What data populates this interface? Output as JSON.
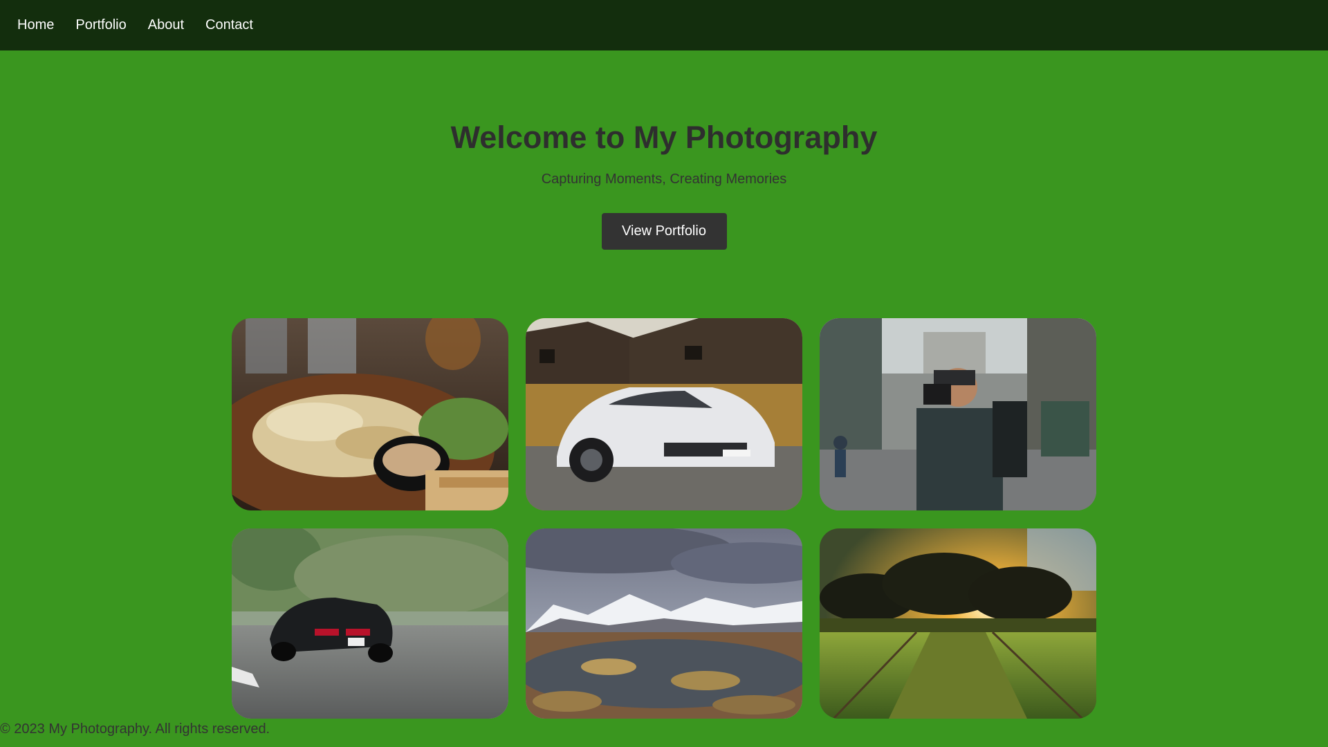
{
  "nav": {
    "items": [
      {
        "label": "Home"
      },
      {
        "label": "Portfolio"
      },
      {
        "label": "About"
      },
      {
        "label": "Contact"
      }
    ]
  },
  "hero": {
    "title": "Welcome to My Photography",
    "subtitle": "Capturing Moments, Creating Memories",
    "cta_label": "View Portfolio"
  },
  "gallery": {
    "photos": [
      {
        "subject": "food-plate-photo"
      },
      {
        "subject": "white-sports-car-photo"
      },
      {
        "subject": "street-photographer-photo"
      },
      {
        "subject": "black-car-motion-photo"
      },
      {
        "subject": "mountain-landscape-photo"
      },
      {
        "subject": "sunset-trees-field-photo"
      }
    ]
  },
  "footer": {
    "text": "© 2023 My Photography. All rights reserved."
  },
  "colors": {
    "page_background": "#3a961f",
    "navbar_background": "#132e0d",
    "button_background": "#333333",
    "text_dark": "#2e2e2e"
  }
}
